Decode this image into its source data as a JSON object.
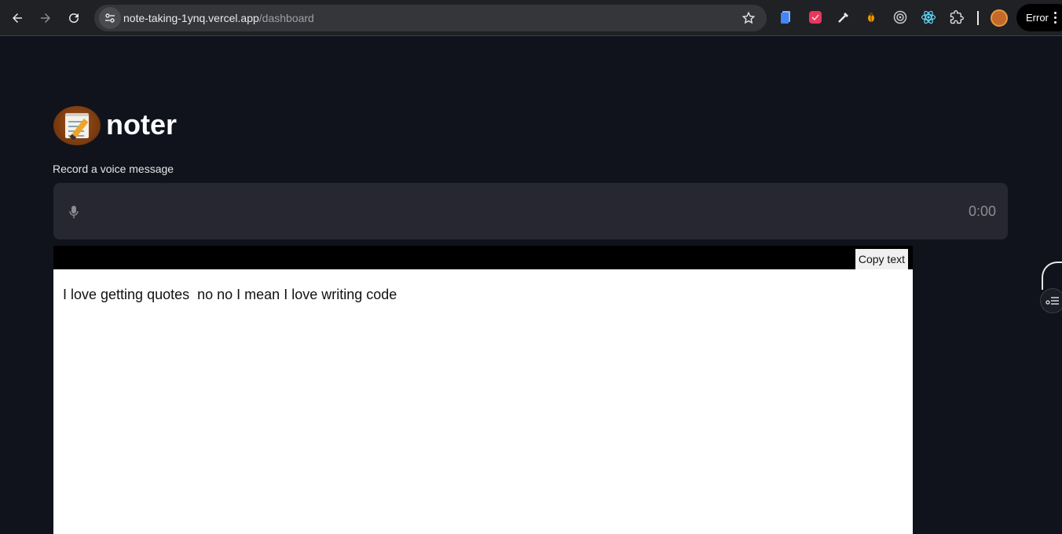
{
  "browser": {
    "url_host": "note-taking-1ynq.vercel.app",
    "url_path": "/dashboard",
    "error_label": "Error"
  },
  "app": {
    "brand": "noter",
    "record_label": "Record a voice message",
    "timer": "0:00",
    "copy_label": "Copy text",
    "note_text": "I love getting quotes  no no I mean I love writing code"
  },
  "colors": {
    "page_bg": "#10131b",
    "recorder_bg": "#262730",
    "editor_bar": "#000000"
  }
}
